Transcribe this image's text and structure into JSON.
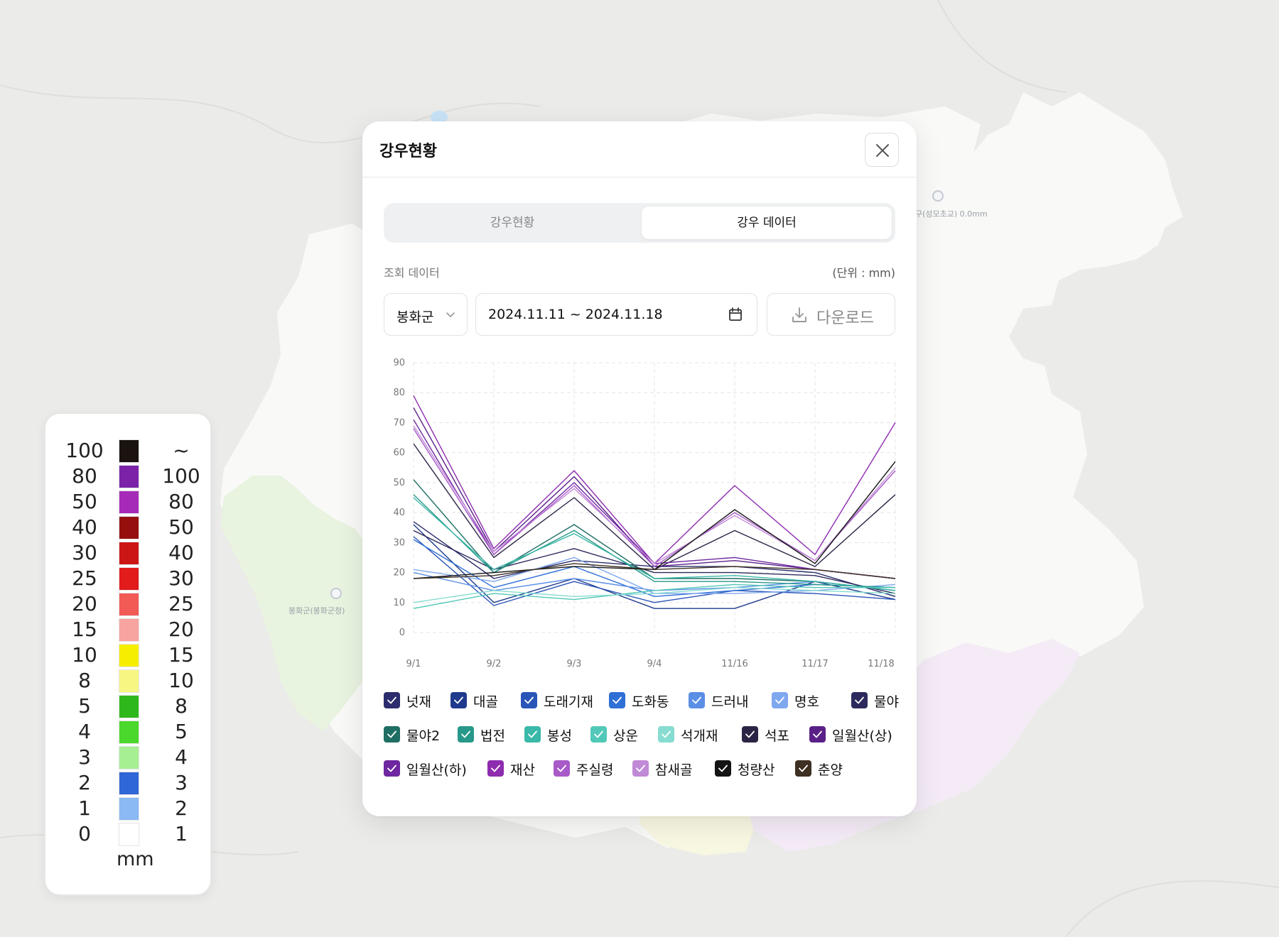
{
  "map": {
    "labels": [
      {
        "name": "map-label-east",
        "text": "구(성모초교) 0.0mm"
      },
      {
        "name": "map-label-west",
        "text": "봉화군(봉화군청)"
      }
    ]
  },
  "legend": {
    "unit": "mm",
    "rows": [
      {
        "left": "100",
        "right": "~",
        "color": "#1a1310"
      },
      {
        "left": "80",
        "right": "100",
        "color": "#7b22a8"
      },
      {
        "left": "50",
        "right": "80",
        "color": "#a62ab8"
      },
      {
        "left": "40",
        "right": "50",
        "color": "#960f0f"
      },
      {
        "left": "30",
        "right": "40",
        "color": "#cc1616"
      },
      {
        "left": "25",
        "right": "30",
        "color": "#e21b1b"
      },
      {
        "left": "20",
        "right": "25",
        "color": "#f25a55"
      },
      {
        "left": "15",
        "right": "20",
        "color": "#f7a39f"
      },
      {
        "left": "10",
        "right": "15",
        "color": "#f6ee00"
      },
      {
        "left": "8",
        "right": "10",
        "color": "#f7f683"
      },
      {
        "left": "5",
        "right": "8",
        "color": "#2fb81b"
      },
      {
        "left": "4",
        "right": "5",
        "color": "#4ad82c"
      },
      {
        "left": "3",
        "right": "4",
        "color": "#a7ef93"
      },
      {
        "left": "2",
        "right": "3",
        "color": "#2f66d8"
      },
      {
        "left": "1",
        "right": "2",
        "color": "#8ab9f4"
      },
      {
        "left": "0",
        "right": "1",
        "color": "#ffffff"
      }
    ]
  },
  "panel": {
    "title": "강우현황",
    "tabs": {
      "status": "강우현황",
      "data": "강우 데이터",
      "active": "data"
    },
    "query_label": "조회 데이터",
    "unit_label": "(단위 : mm)",
    "region": "봉화군",
    "date_range": "2024.11.11 ~ 2024.11.18",
    "download_label": "다운로드",
    "icons": {
      "close": "close-icon",
      "chevron": "chevron-down-icon",
      "calendar": "calendar-icon",
      "download": "download-icon"
    }
  },
  "chart_data": {
    "type": "line",
    "categories": [
      "9/1",
      "9/2",
      "9/3",
      "9/4",
      "11/16",
      "11/17",
      "11/18"
    ],
    "ylim": [
      0,
      90
    ],
    "yticks": [
      0,
      10,
      20,
      30,
      40,
      50,
      60,
      70,
      80,
      90
    ],
    "grid": true,
    "legend_position": "bottom",
    "series": [
      {
        "name": "넛재",
        "color": "#2b2d6e",
        "values": [
          37,
          18,
          24,
          22,
          22,
          20,
          12
        ]
      },
      {
        "name": "대골",
        "color": "#1f3a8c",
        "values": [
          36,
          10,
          18,
          8,
          8,
          17,
          11
        ]
      },
      {
        "name": "도래기재",
        "color": "#2a55b8",
        "values": [
          32,
          9,
          17,
          10,
          14,
          13,
          11
        ]
      },
      {
        "name": "도화동",
        "color": "#2f6fd6",
        "values": [
          31,
          15,
          22,
          12,
          14,
          16,
          15
        ]
      },
      {
        "name": "드러내",
        "color": "#5b8fe6",
        "values": [
          20,
          14,
          18,
          14,
          15,
          17,
          14
        ]
      },
      {
        "name": "명호",
        "color": "#7fa8ee",
        "values": [
          21,
          17,
          25,
          13,
          13,
          14,
          16
        ]
      },
      {
        "name": "물야",
        "color": "#2c2a5c",
        "values": [
          34,
          21,
          28,
          20,
          20,
          19,
          13
        ]
      },
      {
        "name": "물야2",
        "color": "#1f6e64",
        "values": [
          51,
          20,
          36,
          18,
          18,
          17,
          14
        ]
      },
      {
        "name": "법전",
        "color": "#27988a",
        "values": [
          46,
          20,
          34,
          17,
          17,
          16,
          15
        ]
      },
      {
        "name": "봉성",
        "color": "#3ab8a8",
        "values": [
          45,
          21,
          33,
          18,
          19,
          17,
          14
        ]
      },
      {
        "name": "상운",
        "color": "#52c8b8",
        "values": [
          8,
          13,
          11,
          14,
          16,
          15,
          15
        ]
      },
      {
        "name": "석개재",
        "color": "#86dcd0",
        "values": [
          10,
          14,
          12,
          13,
          15,
          14,
          13
        ]
      },
      {
        "name": "석포",
        "color": "#2b2444",
        "values": [
          63,
          25,
          45,
          21,
          34,
          22,
          46
        ]
      },
      {
        "name": "일월산(상)",
        "color": "#5a2088",
        "values": [
          75,
          27,
          52,
          22,
          24,
          21,
          18
        ]
      },
      {
        "name": "일월산(하)",
        "color": "#6e27a0",
        "values": [
          71,
          26,
          50,
          23,
          25,
          21,
          18
        ]
      },
      {
        "name": "재산",
        "color": "#8e2cb0",
        "values": [
          79,
          28,
          54,
          23,
          49,
          26,
          70
        ]
      },
      {
        "name": "주실령",
        "color": "#a85ac8",
        "values": [
          68,
          26,
          49,
          22,
          40,
          24,
          54
        ]
      },
      {
        "name": "참새골",
        "color": "#c08ad6",
        "values": [
          69,
          27,
          48,
          23,
          39,
          24,
          55
        ]
      },
      {
        "name": "청량산",
        "color": "#141414",
        "values": [
          18,
          20,
          22,
          21,
          41,
          23,
          57
        ]
      },
      {
        "name": "춘양",
        "color": "#3e3022",
        "values": [
          18,
          19,
          23,
          21,
          22,
          21,
          18
        ]
      }
    ]
  }
}
